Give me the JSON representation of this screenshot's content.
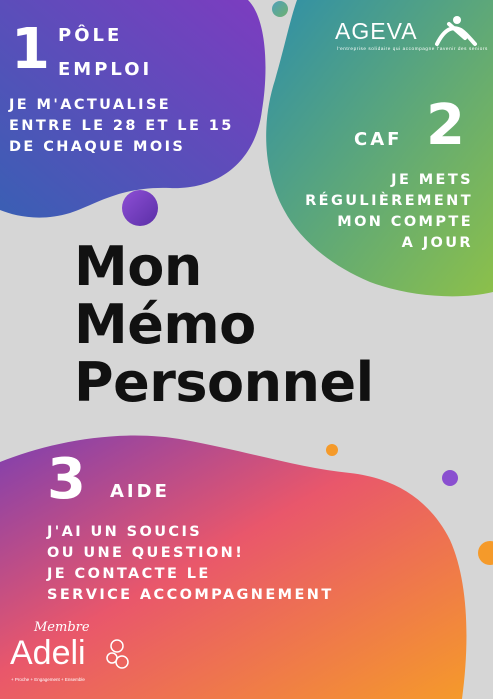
{
  "poster": {
    "title_lines": [
      "Mon",
      "Mémo",
      "Personnel"
    ]
  },
  "section1": {
    "number": "1",
    "heading_line1": "PÔLE",
    "heading_line2": "EMPLOI",
    "text": "JE M'ACTUALISE\nENTRE LE 28 ET LE 15\nDE CHAQUE MOIS"
  },
  "section2": {
    "number": "2",
    "heading": "CAF",
    "text": "JE METS\nRÉGULIÈREMENT\nMON COMPTE\nA JOUR"
  },
  "section3": {
    "number": "3",
    "heading": "AIDE",
    "text": "J'AI UN SOUCIS\nOU UNE QUESTION!\nJE CONTACTE LE\nSERVICE ACCOMPAGNEMENT"
  },
  "logos": {
    "ageva_name": "AGEVA",
    "ageva_tagline": "l'entreprise solidaire qui accompagne l'avenir des seniors",
    "adeli_membre": "Membre",
    "adeli_name": "Adeli",
    "adeli_tagline": "+ Proche  + Engagement  + Ensemble"
  },
  "colors": {
    "background": "#d6d6d6",
    "blob1_start": "#3a5fb4",
    "blob1_end": "#7d3cc0",
    "blob2_start": "#2f8fa8",
    "blob2_end": "#8cc04a",
    "blob3_start": "#7e3fb0",
    "blob3_mid": "#e9576b",
    "blob3_end": "#f59a2a",
    "title_text": "#111111"
  }
}
